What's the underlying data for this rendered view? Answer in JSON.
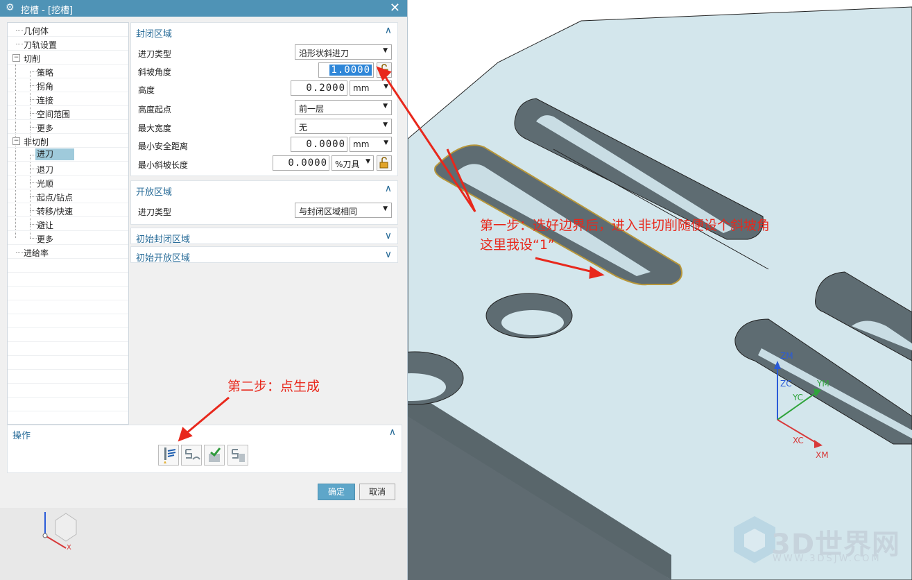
{
  "dialog": {
    "title": "挖槽 - [挖槽]",
    "ok_label": "确定",
    "cancel_label": "取消"
  },
  "tree": [
    {
      "label": "几何体",
      "level": 0
    },
    {
      "label": "刀轨设置",
      "level": 0
    },
    {
      "label": "切削",
      "level": 0,
      "expander": "−"
    },
    {
      "label": "策略",
      "level": 1
    },
    {
      "label": "拐角",
      "level": 1
    },
    {
      "label": "连接",
      "level": 1
    },
    {
      "label": "空间范围",
      "level": 1
    },
    {
      "label": "更多",
      "level": 1
    },
    {
      "label": "非切削",
      "level": 0,
      "expander": "−"
    },
    {
      "label": "进刀",
      "level": 1,
      "selected": true
    },
    {
      "label": "退刀",
      "level": 1
    },
    {
      "label": "光顺",
      "level": 1
    },
    {
      "label": "起点/钻点",
      "level": 1
    },
    {
      "label": "转移/快速",
      "level": 1
    },
    {
      "label": "避让",
      "level": 1
    },
    {
      "label": "更多",
      "level": 1
    },
    {
      "label": "进给率",
      "level": 0
    }
  ],
  "closed_region": {
    "title": "封闭区域",
    "toggle": "∧",
    "engage_type_label": "进刀类型",
    "engage_type_value": "沿形状斜进刀",
    "ramp_angle_label": "斜坡角度",
    "ramp_angle_value": "1.0000",
    "height_label": "高度",
    "height_value": "0.2000",
    "height_unit": "mm",
    "height_from_label": "高度起点",
    "height_from_value": "前一层",
    "max_width_label": "最大宽度",
    "max_width_value": "无",
    "min_clearance_label": "最小安全距离",
    "min_clearance_value": "0.0000",
    "min_clearance_unit": "mm",
    "min_ramp_length_label": "最小斜坡长度",
    "min_ramp_length_value": "0.0000",
    "min_ramp_length_unit": "%刀具"
  },
  "open_region": {
    "title": "开放区域",
    "toggle": "∧",
    "engage_type_label": "进刀类型",
    "engage_type_value": "与封闭区域相同"
  },
  "initial_closed": {
    "title": "初始封闭区域",
    "toggle": "∨"
  },
  "initial_open": {
    "title": "初始开放区域",
    "toggle": "∨"
  },
  "operations": {
    "title": "操作",
    "toggle": "∧"
  },
  "annotations": {
    "step1_line1": "第一步：选好边界后，进入非切削随便设个斜坡角",
    "step1_line2": "这里我设“1”",
    "step2": "第二步：点生成"
  },
  "axes": {
    "zm": "ZM",
    "zc": "ZC",
    "ym": "YM",
    "yc": "YC",
    "xc": "XC",
    "xm": "XM",
    "small_x": "X"
  },
  "watermark": {
    "main": "3D世界网",
    "sub": "WWW.3DSJW.COM"
  },
  "colors": {
    "titlebar": "#4f93b6",
    "accent": "#2a6d99",
    "annotation": "#e8281c",
    "part": "#cfe3ea"
  }
}
